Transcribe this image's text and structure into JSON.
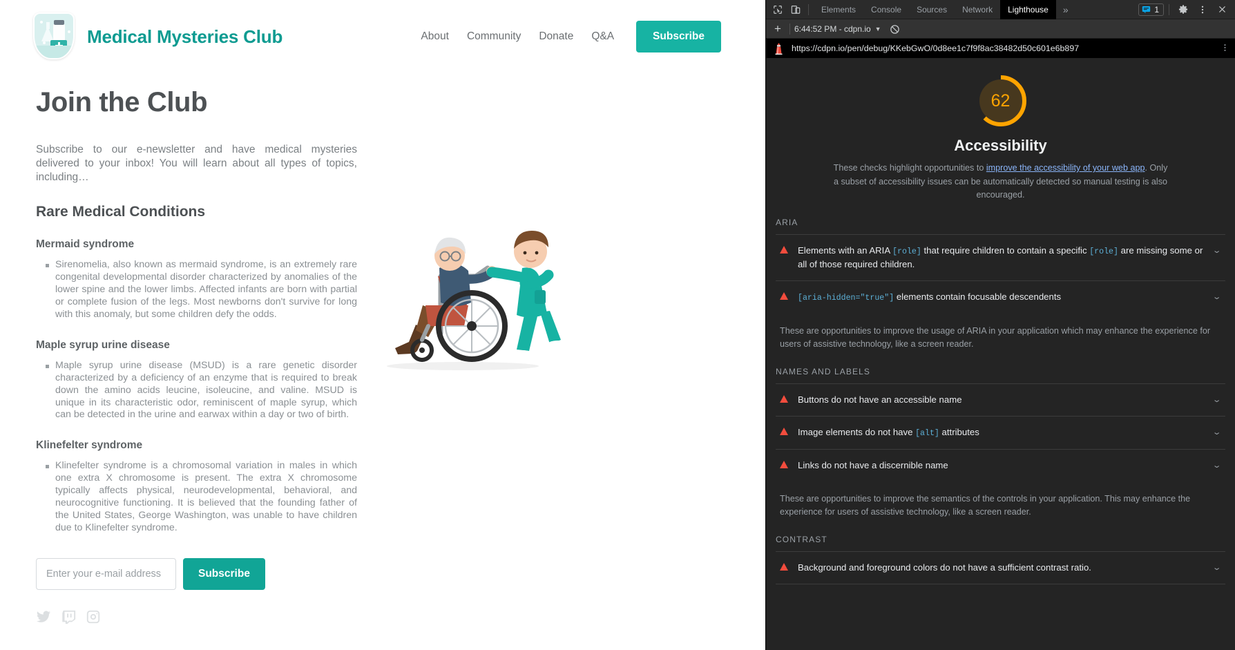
{
  "site": {
    "logo_alt": "medical-shield-logo",
    "title": "Medical Mysteries Club",
    "nav": [
      {
        "label": "About"
      },
      {
        "label": "Community"
      },
      {
        "label": "Donate"
      },
      {
        "label": "Q&A"
      }
    ],
    "subscribe_nav_label": "Subscribe",
    "page_title": "Join the Club",
    "intro": "Subscribe to our e-newsletter and have medical mysteries delivered to your inbox! You will learn about all types of topics, including…",
    "section_heading": "Rare Medical Conditions",
    "conditions": [
      {
        "name": "Mermaid syndrome",
        "body": "Sirenomelia, also known as mermaid syndrome, is an extremely rare congenital developmental disorder characterized by anomalies of the lower spine and the lower limbs. Affected infants are born with partial or complete fusion of the legs. Most newborns don't survive for long with this anomaly, but some children defy the odds."
      },
      {
        "name": "Maple syrup urine disease",
        "body": "Maple syrup urine disease (MSUD) is a rare genetic disorder characterized by a deficiency of an enzyme that is required to break down the amino acids leucine, isoleucine, and valine. MSUD is unique in its characteristic odor, reminiscent of maple syrup, which can be detected in the urine and earwax within a day or two of birth."
      },
      {
        "name": "Klinefelter syndrome",
        "body": "Klinefelter syndrome is a chromosomal variation in males in which one extra X chromosome is present. The extra X chromosome typically affects physical, neurodevelopmental, behavioral, and neurocognitive functioning. It is believed that the founding father of the United States, George Washington, was unable to have children due to Klinefelter syndrome."
      }
    ],
    "email_placeholder": "Enter your e-mail address",
    "email_value": "",
    "subscribe_form_label": "Subscribe",
    "socials": [
      {
        "name": "twitter-icon"
      },
      {
        "name": "twitch-icon"
      },
      {
        "name": "instagram-icon"
      }
    ],
    "illustration_alt": "nurse-pushing-elderly-patient-in-wheelchair",
    "brand_color": "#17b3a3",
    "title_color": "#0e9b91"
  },
  "devtools": {
    "toolbar": {
      "inspect_icon": "inspect-element-icon",
      "device_icon": "device-toolbar-icon",
      "tabs": [
        {
          "label": "Elements",
          "active": false
        },
        {
          "label": "Console",
          "active": false
        },
        {
          "label": "Sources",
          "active": false
        },
        {
          "label": "Network",
          "active": false
        },
        {
          "label": "Lighthouse",
          "active": true
        }
      ],
      "more_tabs_label": "»",
      "issues_count": "1",
      "issues_icon": "issues-console-icon",
      "settings_icon": "gear-icon",
      "kebab_icon": "more-options-icon",
      "close_icon": "close-icon"
    },
    "subbar": {
      "add_label": "+",
      "run_label": "6:44:52 PM - cdpn.io",
      "dropdown_icon": "chevron-down-icon",
      "clear_icon": "clear-all-icon"
    },
    "urlbar": {
      "favicon": "lighthouse-icon",
      "url": "https://cdpn.io/pen/debug/KKebGwO/0d8ee1c7f9f8ac38482d50c601e6b897",
      "kebab_icon": "report-options-icon"
    },
    "report": {
      "score": "62",
      "score_color": "#ffa400",
      "score_max": 100,
      "category": "Accessibility",
      "description_pre": "These checks highlight opportunities to ",
      "description_link": "improve the accessibility of your web app",
      "description_post": ". Only a subset of accessibility issues can be automatically detected so manual testing is also encouraged.",
      "sections": [
        {
          "heading": "ARIA",
          "audits": [
            {
              "parts": [
                {
                  "t": "Elements with an ARIA ",
                  "code": false
                },
                {
                  "t": "[role]",
                  "code": true
                },
                {
                  "t": " that require children to contain a specific ",
                  "code": false
                },
                {
                  "t": "[role]",
                  "code": true
                },
                {
                  "t": " are missing some or all of those required children.",
                  "code": false
                }
              ],
              "status": "fail"
            },
            {
              "parts": [
                {
                  "t": "[aria-hidden=\"true\"]",
                  "code": true
                },
                {
                  "t": " elements contain focusable descendents",
                  "code": false
                }
              ],
              "status": "fail"
            }
          ],
          "note": "These are opportunities to improve the usage of ARIA in your application which may enhance the experience for users of assistive technology, like a screen reader."
        },
        {
          "heading": "NAMES AND LABELS",
          "audits": [
            {
              "parts": [
                {
                  "t": "Buttons do not have an accessible name",
                  "code": false
                }
              ],
              "status": "fail"
            },
            {
              "parts": [
                {
                  "t": "Image elements do not have ",
                  "code": false
                },
                {
                  "t": "[alt]",
                  "code": true
                },
                {
                  "t": " attributes",
                  "code": false
                }
              ],
              "status": "fail"
            },
            {
              "parts": [
                {
                  "t": "Links do not have a discernible name",
                  "code": false
                }
              ],
              "status": "fail"
            }
          ],
          "note": "These are opportunities to improve the semantics of the controls in your application. This may enhance the experience for users of assistive technology, like a screen reader."
        },
        {
          "heading": "CONTRAST",
          "audits": [
            {
              "parts": [
                {
                  "t": "Background and foreground colors do not have a sufficient contrast ratio.",
                  "code": false
                }
              ],
              "status": "fail"
            }
          ],
          "note": ""
        }
      ]
    }
  }
}
